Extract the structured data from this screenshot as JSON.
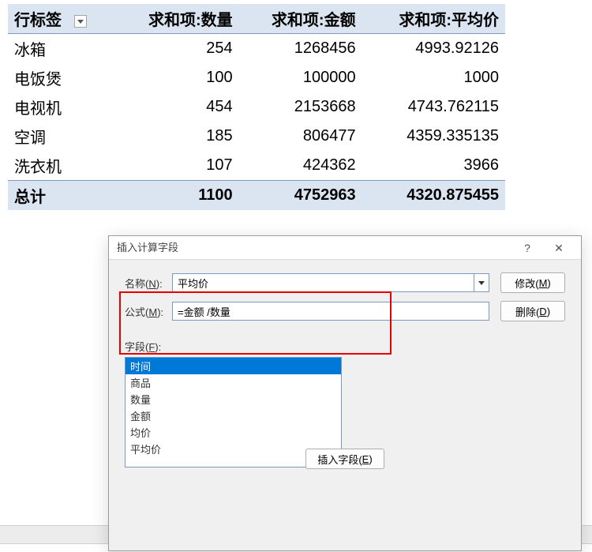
{
  "pivot": {
    "headers": {
      "rowlabel": "行标签",
      "col1": "求和项:数量",
      "col2": "求和项:金额",
      "col3": "求和项:平均价"
    },
    "rows": [
      {
        "label": "冰箱",
        "c1": "254",
        "c2": "1268456",
        "c3": "4993.92126"
      },
      {
        "label": "电饭煲",
        "c1": "100",
        "c2": "100000",
        "c3": "1000"
      },
      {
        "label": "电视机",
        "c1": "454",
        "c2": "2153668",
        "c3": "4743.762115"
      },
      {
        "label": "空调",
        "c1": "185",
        "c2": "806477",
        "c3": "4359.335135"
      },
      {
        "label": "洗衣机",
        "c1": "107",
        "c2": "424362",
        "c3": "3966"
      }
    ],
    "total": {
      "label": "总计",
      "c1": "1100",
      "c2": "4752963",
      "c3": "4320.875455"
    }
  },
  "dialog": {
    "title": "插入计算字段",
    "help": "?",
    "close": "✕",
    "name_label_pre": "名称(",
    "name_label_u": "N",
    "name_label_post": "):",
    "name_value": "平均价",
    "formula_label_pre": "公式(",
    "formula_label_u": "M",
    "formula_label_post": "):",
    "formula_value": "=金额 /数量",
    "modify_pre": "修改(",
    "modify_u": "M",
    "modify_post": ")",
    "delete_pre": "删除(",
    "delete_u": "D",
    "delete_post": ")",
    "fields_label_pre": "字段(",
    "fields_label_u": "F",
    "fields_label_post": "):",
    "fields": [
      "时间",
      "商品",
      "数量",
      "金额",
      "均价",
      "平均价"
    ],
    "insert_pre": "插入字段(",
    "insert_u": "E",
    "insert_post": ")"
  }
}
